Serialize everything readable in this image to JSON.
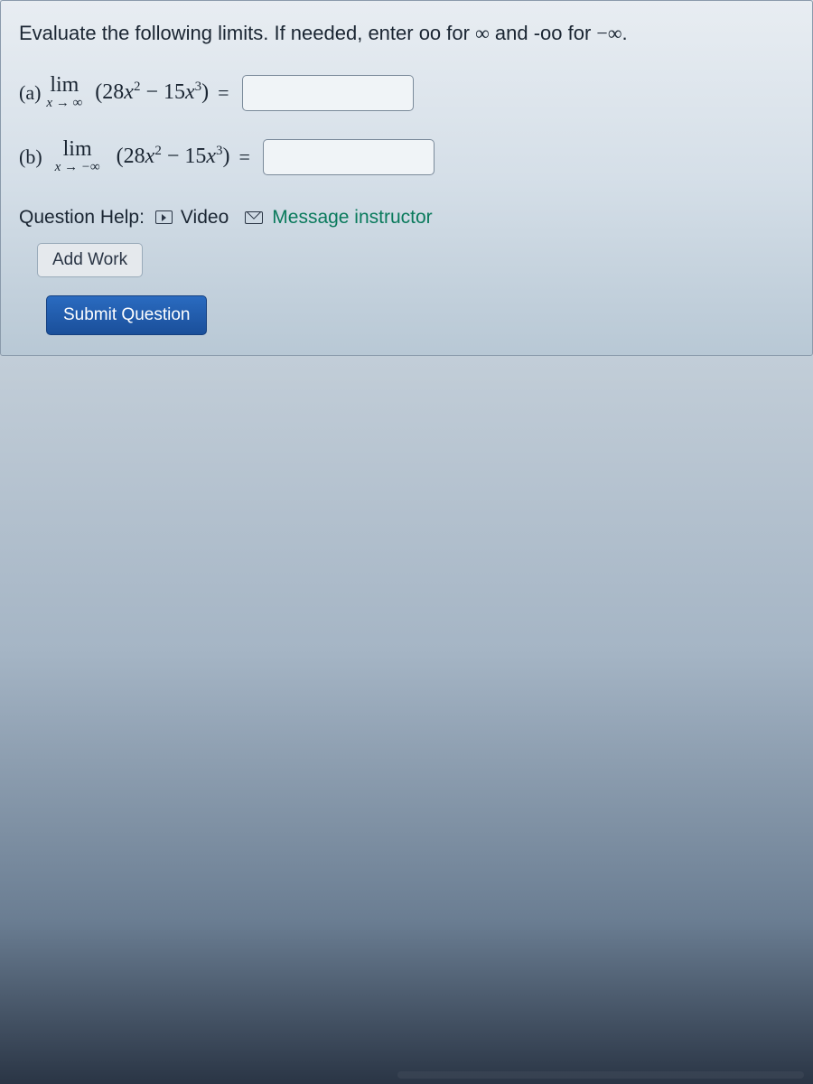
{
  "instruction": {
    "prefix": "Evaluate the following limits. If needed, enter oo for ",
    "inf_symbol_1": "∞",
    "mid": " and -oo for ",
    "neg_inf_symbol": "−∞",
    "suffix": "."
  },
  "parts": {
    "a": {
      "label": "(a)",
      "lim_text": "lim",
      "lim_sub_x": "x",
      "lim_sub_arrow": "→",
      "lim_sub_target": "∞",
      "expr_open": "(28",
      "expr_var1": "x",
      "expr_exp1": "2",
      "expr_minus": " − 15",
      "expr_var2": "x",
      "expr_exp2": "3",
      "expr_close": ")",
      "equals": "=",
      "value": ""
    },
    "b": {
      "label": "(b)",
      "lim_text": "lim",
      "lim_sub_x": "x",
      "lim_sub_arrow": "→",
      "lim_sub_target": "−∞",
      "expr_open": "(28",
      "expr_var1": "x",
      "expr_exp1": "2",
      "expr_minus": " − 15",
      "expr_var2": "x",
      "expr_exp2": "3",
      "expr_close": ")",
      "equals": "=",
      "value": ""
    }
  },
  "help": {
    "label": "Question Help:",
    "video": "Video",
    "message": "Message instructor"
  },
  "buttons": {
    "add_work": "Add Work",
    "submit": "Submit Question"
  }
}
